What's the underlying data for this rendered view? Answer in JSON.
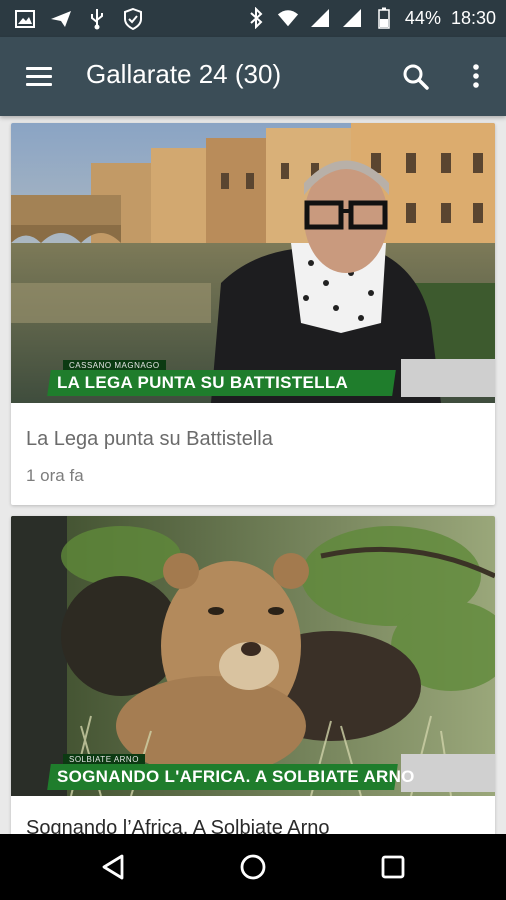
{
  "status_bar": {
    "icons_left": [
      "image-icon",
      "send-icon",
      "usb-icon",
      "shield-icon"
    ],
    "icons_right": [
      "bluetooth-icon",
      "wifi-icon",
      "signal-icon",
      "signal-icon",
      "battery-icon"
    ],
    "battery": "44%",
    "time": "18:30"
  },
  "app_bar": {
    "title": "Gallarate 24 (30)",
    "menu_icon": "hamburger-menu-icon",
    "search_icon": "search-icon",
    "more_icon": "more-vert-icon",
    "background": "#3b4d57"
  },
  "articles": [
    {
      "image_caption_small": "CASSANO MAGNAGO",
      "image_caption": "LA LEGA PUNTA SU BATTISTELLA",
      "title": "La Lega punta su Battistella",
      "time": "1 ora fa"
    },
    {
      "image_caption_small": "SOLBIATE ARNO",
      "image_caption": "SOGNANDO L'AFRICA. A SOLBIATE ARNO",
      "title": "Sognando l’Africa. A Solbiate Arno",
      "time": ""
    }
  ],
  "nav_bar": {
    "back_icon": "back-icon",
    "home_icon": "home-icon",
    "recents_icon": "recents-icon"
  },
  "colors": {
    "status_bar": "#2c3a42",
    "app_bar": "#3b4d57",
    "caption_green": "#1f7d2c",
    "background": "#e9e9e9"
  }
}
